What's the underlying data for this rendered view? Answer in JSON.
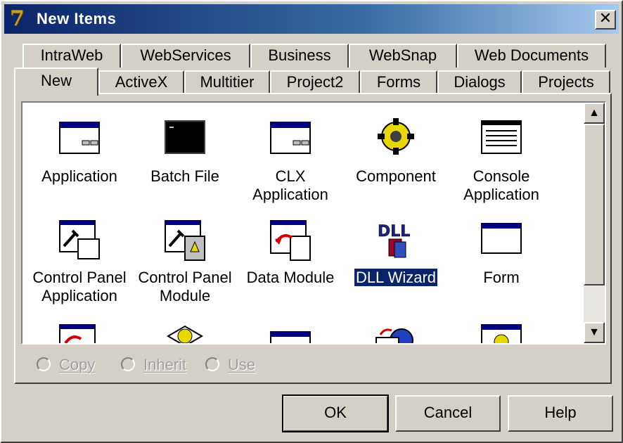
{
  "window": {
    "title": "New Items",
    "close_glyph": "✕",
    "app_icon": "7"
  },
  "tabs_back": [
    "IntraWeb",
    "WebServices",
    "Business",
    "WebSnap",
    "Web Documents"
  ],
  "tabs_front": [
    "New",
    "ActiveX",
    "Multitier",
    "Project2",
    "Forms",
    "Dialogs",
    "Projects"
  ],
  "active_tab": "New",
  "items": [
    {
      "line1": "Application",
      "line2": "",
      "icon": "application-icon"
    },
    {
      "line1": "Batch File",
      "line2": "",
      "icon": "batch-file-icon"
    },
    {
      "line1": "CLX",
      "line2": "Application",
      "icon": "clx-application-icon"
    },
    {
      "line1": "Component",
      "line2": "",
      "icon": "component-gear-icon"
    },
    {
      "line1": "Console",
      "line2": "Application",
      "icon": "console-application-icon"
    },
    {
      "line1": "Control Panel",
      "line2": "Application",
      "icon": "control-panel-application-icon"
    },
    {
      "line1": "Control Panel",
      "line2": "Module",
      "icon": "control-panel-module-icon"
    },
    {
      "line1": "Data Module",
      "line2": "",
      "icon": "data-module-icon"
    },
    {
      "line1": "DLL Wizard",
      "line2": "",
      "icon": "dll-wizard-icon",
      "selected": true
    },
    {
      "line1": "Form",
      "line2": "",
      "icon": "form-icon"
    }
  ],
  "radios": [
    {
      "label": "Copy"
    },
    {
      "label": "Inherit"
    },
    {
      "label": "Use"
    }
  ],
  "buttons": {
    "ok": "OK",
    "cancel": "Cancel",
    "help": "Help"
  },
  "colors": {
    "selection": "#0a246a",
    "titlebar": "#0a246a",
    "face": "#d4d0c8"
  }
}
